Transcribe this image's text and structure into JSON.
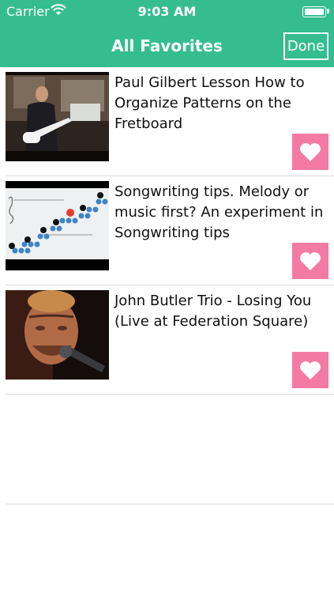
{
  "status_bar": {
    "carrier": "Carrier",
    "time": "9:03 AM"
  },
  "nav": {
    "title": "All Favorites",
    "done_label": "Done"
  },
  "favorites": [
    {
      "title": "Paul Gilbert Lesson How to Organize Patterns on the Fretboard"
    },
    {
      "title": "Songwriting tips. Melody or music first? An experiment in Songwriting tips"
    },
    {
      "title": "John Butler Trio - Losing You (Live at Federation Square)"
    }
  ],
  "colors": {
    "nav_bg": "#35bd8f",
    "heart_bg": "#f37aa3"
  },
  "icons": [
    "wifi-icon",
    "battery-icon",
    "heart-icon"
  ]
}
